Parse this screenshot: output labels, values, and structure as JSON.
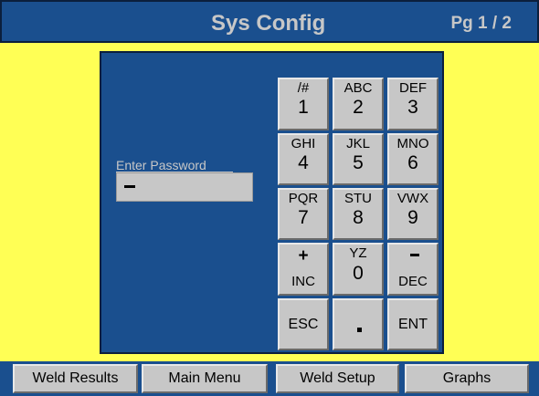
{
  "header": {
    "title": "Sys Config",
    "page_indicator": "Pg 1 / 2"
  },
  "password": {
    "label": "Enter Password"
  },
  "keypad": {
    "k1": {
      "sub": "/#",
      "main": "1"
    },
    "k2": {
      "sub": "ABC",
      "main": "2"
    },
    "k3": {
      "sub": "DEF",
      "main": "3"
    },
    "k4": {
      "sub": "GHI",
      "main": "4"
    },
    "k5": {
      "sub": "JKL",
      "main": "5"
    },
    "k6": {
      "sub": "MNO",
      "main": "6"
    },
    "k7": {
      "sub": "PQR",
      "main": "7"
    },
    "k8": {
      "sub": "STU",
      "main": "8"
    },
    "k9": {
      "sub": "VWX",
      "main": "9"
    },
    "inc": {
      "sub": "+",
      "main": "INC"
    },
    "k0": {
      "sub": "YZ",
      "main": "0"
    },
    "dec": {
      "main": "DEC"
    },
    "esc": "ESC",
    "ent": "ENT"
  },
  "footer": {
    "weld_results": "Weld Results",
    "main_menu": "Main Menu",
    "weld_setup": "Weld Setup",
    "graphs": "Graphs"
  }
}
